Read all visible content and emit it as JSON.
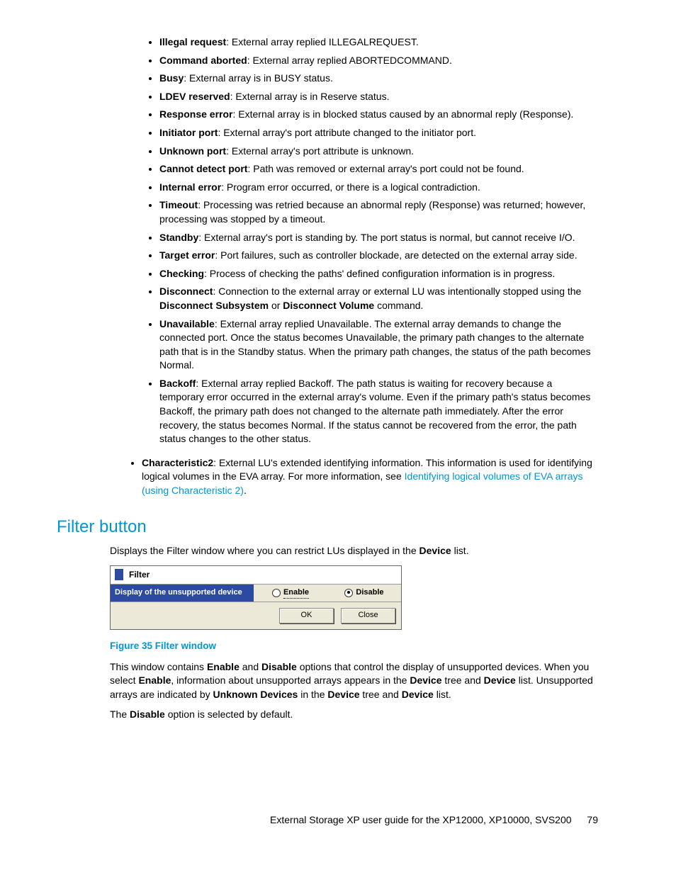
{
  "statuses": [
    {
      "term": "Illegal request",
      "desc": ": External array replied ILLEGALREQUEST."
    },
    {
      "term": "Command aborted",
      "desc": ": External array replied ABORTEDCOMMAND."
    },
    {
      "term": "Busy",
      "desc": ": External array is in BUSY status."
    },
    {
      "term": "LDEV reserved",
      "desc": ": External array is in Reserve status."
    },
    {
      "term": "Response error",
      "desc": ": External array is in blocked status caused by an abnormal reply (Response)."
    },
    {
      "term": "Initiator port",
      "desc": ": External array's port attribute changed to the initiator port."
    },
    {
      "term": "Unknown port",
      "desc": ": External array's port attribute is unknown."
    },
    {
      "term": "Cannot detect port",
      "desc": ": Path was removed or external array's port could not be found."
    },
    {
      "term": "Internal error",
      "desc": ": Program error occurred, or there is a logical contradiction."
    },
    {
      "term": "Timeout",
      "desc": ": Processing was retried because an abnormal reply (Response) was returned; however, processing was stopped by a timeout."
    },
    {
      "term": "Standby",
      "desc": ": External array's port is standing by. The port status is normal, but cannot receive I/O."
    },
    {
      "term": "Target error",
      "desc": ": Port failures, such as controller blockade, are detected on the external array side."
    },
    {
      "term": "Checking",
      "desc": ": Process of checking the paths' defined configuration information is in progress."
    }
  ],
  "disconnect": {
    "term": "Disconnect",
    "lead": ": Connection to the external array or external LU was intentionally stopped using the ",
    "b1": "Disconnect Subsystem",
    "mid": " or ",
    "b2": "Disconnect Volume",
    "tail": " command."
  },
  "unavailable": {
    "term": "Unavailable",
    "desc": ": External array replied Unavailable. The external array demands to change the connected port. Once the status becomes Unavailable, the primary path changes to the alternate path that is in the Standby status. When the primary path changes, the status of the path becomes Normal."
  },
  "backoff": {
    "term": "Backoff",
    "desc": ": External array replied Backoff. The path status is waiting for recovery because a temporary error occurred in the external array's volume. Even if the primary path's status becomes Backoff, the primary path does not changed to the alternate path immediately. After the error recovery, the status becomes Normal. If the status cannot be recovered from the error, the path status changes to the other status."
  },
  "char2": {
    "term": "Characteristic2",
    "lead": ": External LU's extended identifying information. This information is used for identifying logical volumes in the EVA array. For more information, see ",
    "link": "Identifying logical volumes of EVA arrays (using Characteristic 2)",
    "tail": "."
  },
  "section": {
    "title": "Filter button",
    "intro_a": "Displays the Filter window where you can restrict LUs displayed in the ",
    "intro_b": "Device",
    "intro_c": " list."
  },
  "filterWindow": {
    "title": "Filter",
    "rowLabel": "Display of the unsupported device",
    "enable": "Enable",
    "disable": "Disable",
    "ok": "OK",
    "close": "Close"
  },
  "figCaption": "Figure 35 Filter window",
  "para1": {
    "a": "This window contains ",
    "b": "Enable",
    "c": " and ",
    "d": "Disable",
    "e": " options that control the display of unsupported devices. When you select ",
    "f": "Enable",
    "g": ", information about unsupported arrays appears in the ",
    "h": "Device",
    "i": " tree and ",
    "j": "Device",
    "k": " list. Unsupported arrays are indicated by ",
    "l": "Unknown Devices",
    "m": " in the ",
    "n": "Device",
    "o": " tree and ",
    "p": "Device",
    "q": " list."
  },
  "para2": {
    "a": "The ",
    "b": "Disable",
    "c": " option is selected by default."
  },
  "footer": {
    "text": "External Storage XP user guide for the XP12000, XP10000, SVS200",
    "page": "79"
  }
}
